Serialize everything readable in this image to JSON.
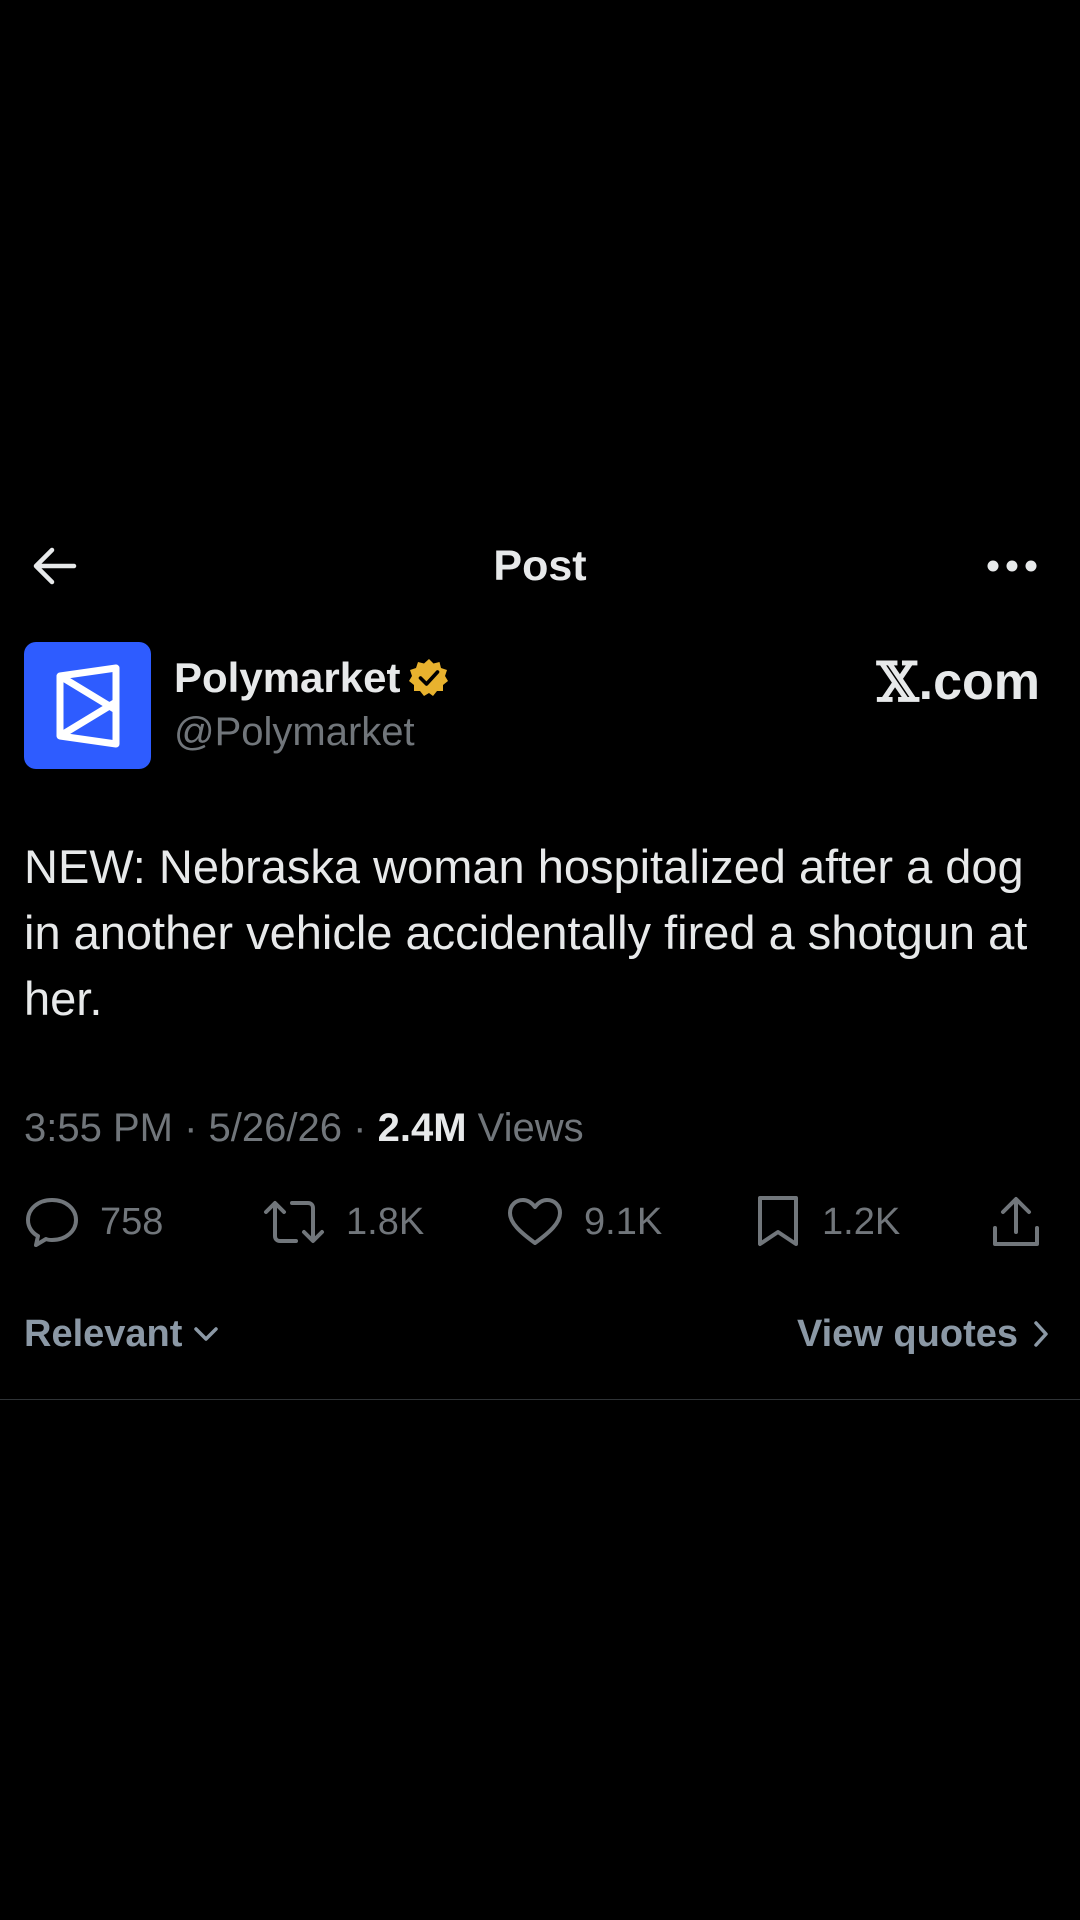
{
  "header": {
    "title": "Post",
    "back_icon": "arrow-left-icon",
    "more_icon": "more-horizontal-icon"
  },
  "author": {
    "display_name": "Polymarket",
    "handle": "@Polymarket",
    "verified_icon": "verified-badge-icon",
    "verified_color": "#e8b22e",
    "avatar_color": "#2e5cff",
    "source_symbol": "𝕏",
    "source_suffix": ".com"
  },
  "post": {
    "text": "NEW: Nebraska woman hospitalized after a dog in another vehicle accidentally fired a shotgun at her.",
    "time": "3:55 PM",
    "date": "5/26/26",
    "separator": "·",
    "views_count": "2.4M",
    "views_label": "Views"
  },
  "actions": {
    "reply_count": "758",
    "repost_count": "1.8K",
    "like_count": "9.1K",
    "bookmark_count": "1.2K"
  },
  "subbar": {
    "sort_label": "Relevant",
    "quotes_label": "View quotes"
  },
  "colors": {
    "background": "#000000",
    "text_primary": "#e7e9ea",
    "text_secondary": "#71767b",
    "divider": "#2f3336"
  }
}
